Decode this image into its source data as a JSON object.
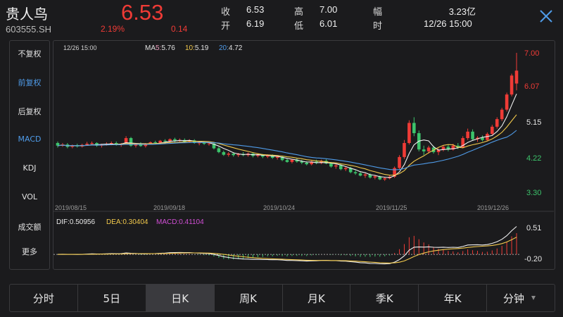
{
  "header": {
    "name": "贵人鸟",
    "code": "603555.SH",
    "price": "6.53",
    "change_pct": "2.19%",
    "change": "0.14",
    "quote": [
      {
        "label": "收",
        "value": "6.53"
      },
      {
        "label": "开",
        "value": "6.19"
      },
      {
        "label": "高",
        "value": "7.00"
      },
      {
        "label": "低",
        "value": "6.01"
      },
      {
        "label": "幅",
        "value": "3.23亿"
      },
      {
        "label": "时",
        "value": "12/26 15:00"
      }
    ]
  },
  "left_menu": [
    {
      "label": "不复权",
      "active": false
    },
    {
      "label": "前复权",
      "active": true
    },
    {
      "label": "后复权",
      "active": false
    },
    {
      "label": "MACD",
      "active": true
    },
    {
      "label": "KDJ",
      "active": false
    },
    {
      "label": "VOL",
      "active": false
    },
    {
      "label": "成交额",
      "active": false
    },
    {
      "label": "更多",
      "active": false
    }
  ],
  "chart": {
    "timestamp": "12/26 15:00",
    "ma": [
      {
        "label": "MA5:",
        "value": "5.76",
        "color": "#f0a0c0"
      },
      {
        "label": "10:",
        "value": "5.19",
        "color": "#f2c94c"
      },
      {
        "label": "20:",
        "value": "4.72",
        "color": "#4f9be8"
      }
    ],
    "dates": [
      "2019/08/15",
      "2019/09/18",
      "2019/10/24",
      "2019/11/25",
      "2019/12/26"
    ],
    "price_axis": [
      "7.00",
      "6.07",
      "5.15",
      "4.22",
      "3.30"
    ],
    "macd_legend": {
      "dif": "DIF:0.50956",
      "dea": "DEA:0.30404",
      "macd": "MACD:0.41104"
    },
    "macd_axis": [
      "0.51",
      "-0.20"
    ]
  },
  "tabs": [
    {
      "label": "分时",
      "active": false
    },
    {
      "label": "5日",
      "active": false
    },
    {
      "label": "日K",
      "active": true
    },
    {
      "label": "周K",
      "active": false
    },
    {
      "label": "月K",
      "active": false
    },
    {
      "label": "季K",
      "active": false
    },
    {
      "label": "年K",
      "active": false
    },
    {
      "label": "分钟",
      "active": false
    }
  ],
  "chart_data": {
    "type": "candlestick",
    "ylim": [
      3.3,
      7.0
    ],
    "candles_ohlc": [
      [
        4.62,
        4.66,
        4.5,
        4.55
      ],
      [
        4.55,
        4.62,
        4.52,
        4.58
      ],
      [
        4.58,
        4.62,
        4.48,
        4.52
      ],
      [
        4.52,
        4.58,
        4.48,
        4.56
      ],
      [
        4.56,
        4.6,
        4.5,
        4.53
      ],
      [
        4.53,
        4.6,
        4.5,
        4.57
      ],
      [
        4.57,
        4.65,
        4.55,
        4.6
      ],
      [
        4.6,
        4.66,
        4.56,
        4.62
      ],
      [
        4.62,
        4.64,
        4.52,
        4.55
      ],
      [
        4.55,
        4.6,
        4.5,
        4.58
      ],
      [
        4.58,
        4.64,
        4.55,
        4.6
      ],
      [
        4.6,
        4.66,
        4.56,
        4.62
      ],
      [
        4.62,
        4.66,
        4.55,
        4.57
      ],
      [
        4.57,
        4.62,
        4.52,
        4.6
      ],
      [
        4.6,
        4.8,
        4.58,
        4.75
      ],
      [
        4.75,
        4.78,
        4.52,
        4.55
      ],
      [
        4.55,
        4.62,
        4.5,
        4.58
      ],
      [
        4.58,
        4.64,
        4.52,
        4.54
      ],
      [
        4.54,
        4.62,
        4.5,
        4.6
      ],
      [
        4.6,
        4.66,
        4.58,
        4.64
      ],
      [
        4.64,
        4.68,
        4.58,
        4.62
      ],
      [
        4.62,
        4.7,
        4.6,
        4.68
      ],
      [
        4.68,
        4.72,
        4.62,
        4.66
      ],
      [
        4.66,
        4.74,
        4.64,
        4.72
      ],
      [
        4.72,
        4.76,
        4.64,
        4.68
      ],
      [
        4.68,
        4.74,
        4.62,
        4.7
      ],
      [
        4.7,
        4.74,
        4.62,
        4.65
      ],
      [
        4.65,
        4.72,
        4.62,
        4.69
      ],
      [
        4.69,
        4.72,
        4.6,
        4.62
      ],
      [
        4.62,
        4.66,
        4.56,
        4.63
      ],
      [
        4.63,
        4.66,
        4.57,
        4.6
      ],
      [
        4.6,
        4.64,
        4.55,
        4.61
      ],
      [
        4.61,
        4.63,
        4.45,
        4.48
      ],
      [
        4.48,
        4.52,
        4.35,
        4.38
      ],
      [
        4.38,
        4.42,
        4.28,
        4.31
      ],
      [
        4.31,
        4.38,
        4.26,
        4.34
      ],
      [
        4.34,
        4.38,
        4.26,
        4.3
      ],
      [
        4.3,
        4.36,
        4.25,
        4.33
      ],
      [
        4.33,
        4.38,
        4.27,
        4.3
      ],
      [
        4.3,
        4.37,
        4.26,
        4.34
      ],
      [
        4.34,
        4.36,
        4.24,
        4.28
      ],
      [
        4.28,
        4.34,
        4.24,
        4.31
      ],
      [
        4.31,
        4.33,
        4.22,
        4.26
      ],
      [
        4.26,
        4.32,
        4.22,
        4.29
      ],
      [
        4.29,
        4.32,
        4.2,
        4.23
      ],
      [
        4.23,
        4.28,
        4.18,
        4.26
      ],
      [
        4.26,
        4.28,
        4.14,
        4.17
      ],
      [
        4.17,
        4.22,
        4.1,
        4.12
      ],
      [
        4.12,
        4.2,
        4.08,
        4.18
      ],
      [
        4.18,
        4.22,
        4.1,
        4.13
      ],
      [
        4.13,
        4.18,
        4.06,
        4.1
      ],
      [
        4.1,
        4.14,
        4.03,
        4.06
      ],
      [
        4.06,
        4.15,
        4.03,
        4.13
      ],
      [
        4.13,
        4.18,
        4.06,
        4.09
      ],
      [
        4.09,
        4.18,
        4.06,
        4.15
      ],
      [
        4.15,
        4.19,
        4.06,
        4.08
      ],
      [
        4.08,
        4.12,
        3.97,
        4.0
      ],
      [
        4.0,
        4.06,
        3.94,
        4.03
      ],
      [
        4.03,
        4.06,
        3.9,
        3.93
      ],
      [
        3.93,
        4.0,
        3.88,
        3.96
      ],
      [
        3.96,
        3.99,
        3.82,
        3.85
      ],
      [
        3.85,
        3.9,
        3.78,
        3.82
      ],
      [
        3.82,
        3.86,
        3.74,
        3.76
      ],
      [
        3.76,
        3.82,
        3.7,
        3.79
      ],
      [
        3.79,
        3.82,
        3.68,
        3.71
      ],
      [
        3.71,
        3.78,
        3.66,
        3.74
      ],
      [
        3.74,
        3.76,
        3.64,
        3.66
      ],
      [
        3.66,
        3.72,
        3.62,
        3.69
      ],
      [
        3.69,
        3.76,
        3.66,
        3.73
      ],
      [
        3.73,
        4.0,
        3.7,
        3.96
      ],
      [
        3.96,
        4.3,
        3.92,
        4.25
      ],
      [
        4.25,
        4.7,
        4.2,
        4.62
      ],
      [
        4.62,
        5.22,
        4.58,
        5.15
      ],
      [
        5.15,
        5.3,
        4.8,
        4.88
      ],
      [
        4.88,
        4.95,
        4.4,
        4.45
      ],
      [
        4.45,
        4.55,
        4.3,
        4.4
      ],
      [
        4.4,
        4.55,
        4.34,
        4.5
      ],
      [
        4.5,
        4.55,
        4.34,
        4.38
      ],
      [
        4.38,
        4.48,
        4.3,
        4.44
      ],
      [
        4.44,
        4.56,
        4.4,
        4.52
      ],
      [
        4.52,
        4.58,
        4.4,
        4.45
      ],
      [
        4.45,
        4.6,
        4.42,
        4.55
      ],
      [
        4.55,
        4.62,
        4.46,
        4.5
      ],
      [
        4.5,
        4.8,
        4.48,
        4.75
      ],
      [
        4.75,
        5.0,
        4.7,
        4.92
      ],
      [
        4.92,
        4.98,
        4.68,
        4.72
      ],
      [
        4.72,
        4.8,
        4.65,
        4.76
      ],
      [
        4.76,
        4.82,
        4.66,
        4.7
      ],
      [
        4.7,
        4.9,
        4.68,
        4.86
      ],
      [
        4.86,
        5.1,
        4.82,
        5.05
      ],
      [
        5.05,
        5.3,
        5.0,
        5.25
      ],
      [
        5.25,
        5.55,
        5.2,
        5.5
      ],
      [
        5.5,
        5.95,
        5.45,
        5.9
      ],
      [
        5.9,
        6.45,
        5.85,
        6.4
      ],
      [
        6.19,
        7.0,
        6.01,
        6.53
      ]
    ],
    "macd_axis": [
      -0.2,
      0.51
    ]
  }
}
